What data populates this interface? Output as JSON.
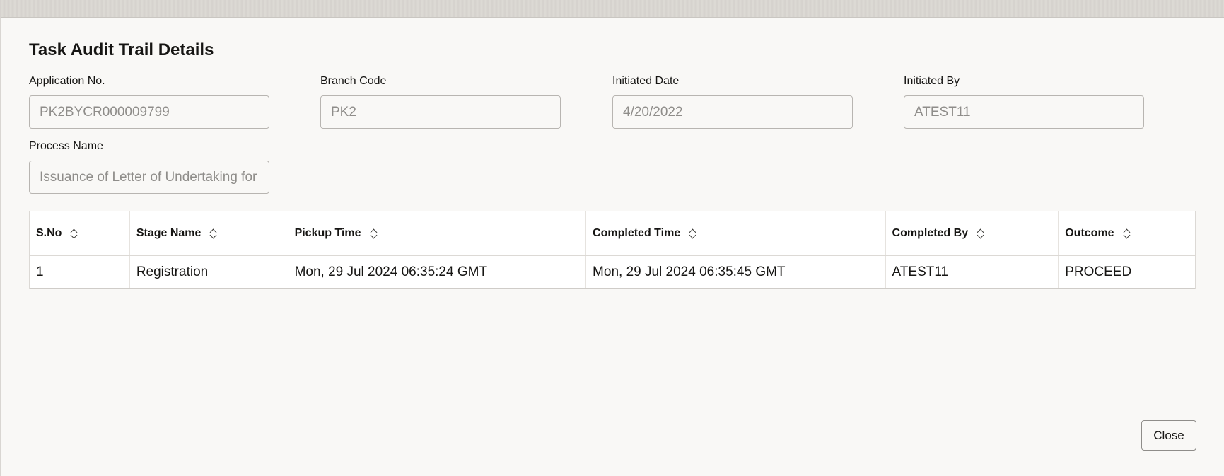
{
  "dialog": {
    "title": "Task Audit Trail Details"
  },
  "fields": {
    "application_no": {
      "label": "Application No.",
      "value": "PK2BYCR000009799"
    },
    "branch_code": {
      "label": "Branch Code",
      "value": "PK2"
    },
    "initiated_date": {
      "label": "Initiated Date",
      "value": "4/20/2022"
    },
    "initiated_by": {
      "label": "Initiated By",
      "value": "ATEST11"
    },
    "process_name": {
      "label": "Process Name",
      "value": "Issuance of Letter of Undertaking for"
    }
  },
  "table": {
    "headers": [
      "S.No",
      "Stage Name",
      "Pickup Time",
      "Completed Time",
      "Completed By",
      "Outcome"
    ],
    "rows": [
      [
        "1",
        "Registration",
        "Mon, 29 Jul 2024 06:35:24 GMT",
        "Mon, 29 Jul 2024 06:35:45 GMT",
        "ATEST11",
        "PROCEED"
      ]
    ],
    "sort_icon": "sort-up-down-icon"
  },
  "footer": {
    "close_label": "Close"
  },
  "colors": {
    "background": "#f9f8f6",
    "text": "#161513",
    "input_text": "#8f8d8a",
    "border": "#b8b5b1"
  }
}
